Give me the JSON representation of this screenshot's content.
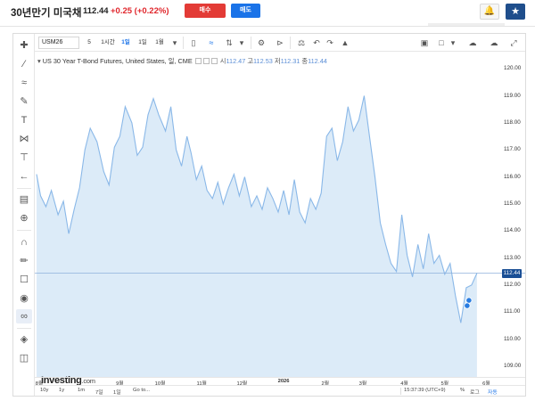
{
  "header": {
    "title": "30년만기 미국채",
    "price": "112.44",
    "change": "+0.25 (+0.22%)",
    "sell_label": "매수",
    "buy_label": "매도",
    "alert_icon": "bell-plus-icon",
    "watch_icon": "star-icon",
    "accent_red": "#e0262c",
    "accent_blue": "#1a73e8"
  },
  "toolbar": {
    "symbol": "USM26",
    "intervals": [
      "5",
      "1시간",
      "1일",
      "1일",
      "1월"
    ],
    "active_interval": "1일",
    "icons": [
      "candles-icon",
      "area-chart-icon",
      "bar-chart-icon",
      "settings-icon",
      "compare-icon",
      "scale-icon",
      "undo-icon",
      "redo-icon",
      "indicator-icon",
      "camera-icon",
      "layout-icon",
      "cloud-upload-icon",
      "cloud-download-icon",
      "fullscreen-icon"
    ]
  },
  "left_tools": [
    "crosshair-icon",
    "trend-line-icon",
    "fib-icon",
    "brush-icon",
    "text-icon",
    "pattern-icon",
    "measure-icon",
    "back-arrow-icon",
    "ruler-icon",
    "zoom-icon",
    "magnet-icon",
    "pencil-lock-icon",
    "lock-icon",
    "eye-icon",
    "link-icon",
    "layers-icon",
    "trash-icon"
  ],
  "legend": {
    "name": "US 30 Year T-Bond Futures, United States, 일, CME",
    "open_label": "시",
    "open": "112.47",
    "high_label": "고",
    "high": "112.53",
    "low_label": "저",
    "low": "112.31",
    "close_label": "종",
    "close": "112.44"
  },
  "logo": {
    "brand": "Investing",
    "suffix": ".com"
  },
  "bottom_bar": {
    "ranges": [
      "10y",
      "1y",
      "1m",
      "7일",
      "1일",
      "Go to..."
    ],
    "clock": "15:37:39 (UTC+9)",
    "log_label": "로그",
    "auto_label": "자동"
  },
  "chart_data": {
    "type": "area",
    "ylim": [
      108.6,
      120.6
    ],
    "yticks": [
      109,
      110,
      111,
      112,
      113,
      114,
      115,
      116,
      117,
      118,
      119,
      120
    ],
    "last_value": "112.44",
    "xticks": [
      {
        "label": "8월",
        "bold": false
      },
      {
        "label": "9월",
        "bold": false
      },
      {
        "label": "10월",
        "bold": false
      },
      {
        "label": "11월",
        "bold": false
      },
      {
        "label": "12월",
        "bold": false
      },
      {
        "label": "2026",
        "bold": true
      },
      {
        "label": "2월",
        "bold": false
      },
      {
        "label": "3월",
        "bold": false
      },
      {
        "label": "4월",
        "bold": false
      },
      {
        "label": "5월",
        "bold": false
      },
      {
        "label": "6월",
        "bold": false
      }
    ],
    "x": [
      "2025-07-01",
      "2025-07-04",
      "2025-07-08",
      "2025-07-12",
      "2025-07-17",
      "2025-07-21",
      "2025-07-25",
      "2025-07-29",
      "2025-08-02",
      "2025-08-06",
      "2025-08-10",
      "2025-08-15",
      "2025-08-20",
      "2025-08-24",
      "2025-08-28",
      "2025-09-01",
      "2025-09-05",
      "2025-09-10",
      "2025-09-14",
      "2025-09-18",
      "2025-09-22",
      "2025-09-26",
      "2025-09-30",
      "2025-10-05",
      "2025-10-09",
      "2025-10-13",
      "2025-10-17",
      "2025-10-21",
      "2025-10-24",
      "2025-10-28",
      "2025-11-01",
      "2025-11-05",
      "2025-11-09",
      "2025-11-13",
      "2025-11-17",
      "2025-11-21",
      "2025-11-25",
      "2025-11-29",
      "2025-12-03",
      "2025-12-08",
      "2025-12-12",
      "2025-12-16",
      "2025-12-20",
      "2025-12-24",
      "2025-12-28",
      "2026-01-01",
      "2026-01-05",
      "2026-01-09",
      "2026-01-13",
      "2026-01-17",
      "2026-01-21",
      "2026-01-25",
      "2026-01-29",
      "2026-02-02",
      "2026-02-06",
      "2026-02-10",
      "2026-02-14",
      "2026-02-18",
      "2026-02-22",
      "2026-02-26",
      "2026-03-02",
      "2026-03-06",
      "2026-03-10",
      "2026-03-14",
      "2026-03-18",
      "2026-03-22",
      "2026-03-26",
      "2026-03-30",
      "2026-04-03",
      "2026-04-07",
      "2026-04-11",
      "2026-04-15",
      "2026-04-19",
      "2026-04-23",
      "2026-04-27",
      "2026-05-01",
      "2026-05-05",
      "2026-05-09",
      "2026-05-13",
      "2026-05-17",
      "2026-05-21",
      "2026-05-25"
    ],
    "values": [
      116.1,
      115.3,
      114.9,
      115.5,
      114.6,
      115.1,
      113.9,
      114.8,
      115.6,
      117.0,
      117.8,
      117.3,
      116.2,
      115.7,
      117.1,
      117.5,
      118.6,
      118.0,
      116.8,
      117.1,
      118.3,
      118.9,
      118.3,
      117.7,
      118.6,
      117.0,
      116.4,
      117.5,
      116.9,
      115.9,
      116.4,
      115.5,
      115.2,
      115.8,
      115.0,
      115.6,
      116.1,
      115.3,
      116.0,
      114.9,
      115.3,
      114.8,
      115.6,
      115.2,
      114.7,
      115.5,
      114.6,
      115.9,
      114.7,
      114.3,
      115.2,
      114.8,
      115.4,
      117.5,
      117.8,
      116.6,
      117.3,
      118.6,
      117.7,
      118.1,
      119.0,
      117.5,
      116.0,
      114.3,
      113.5,
      112.8,
      112.5,
      114.6,
      113.1,
      112.3,
      113.5,
      112.6,
      113.9,
      112.8,
      113.1,
      112.4,
      112.8,
      111.6,
      110.6,
      111.9,
      112.0,
      112.44
    ],
    "marker_value": 111.4,
    "grid": false,
    "fill_color": "#dcebf8",
    "line_color": "#8ab8e8"
  }
}
